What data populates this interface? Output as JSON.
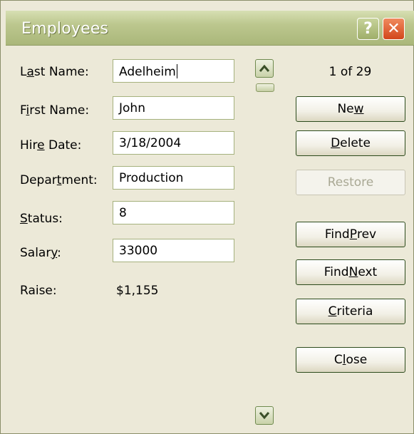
{
  "window": {
    "title": "Employees"
  },
  "titlebar": {
    "help_label": "?",
    "close_label": "✕"
  },
  "fields": {
    "last_name": {
      "label_pre": "L",
      "label_ul": "a",
      "label_post": "st Name:",
      "value": "Adelheim"
    },
    "first_name": {
      "label_pre": "F",
      "label_ul": "i",
      "label_post": "rst Name:",
      "value": "John"
    },
    "hire_date": {
      "label_pre": "Hir",
      "label_ul": "e",
      "label_post": " Date:",
      "value": "3/18/2004"
    },
    "department": {
      "label_pre": "Depar",
      "label_ul": "t",
      "label_post": "ment:",
      "value": "Production"
    },
    "status": {
      "label_pre": "",
      "label_ul": "S",
      "label_post": "tatus:",
      "value": "8"
    },
    "salary": {
      "label_pre": "Salar",
      "label_ul": "y",
      "label_post": ":",
      "value": "33000"
    }
  },
  "raise": {
    "label": "Raise:",
    "value": "$1,155"
  },
  "record_counter": "1 of 29",
  "buttons": {
    "new": {
      "pre": "Ne",
      "ul": "w",
      "post": ""
    },
    "delete": {
      "pre": "",
      "ul": "D",
      "post": "elete"
    },
    "restore": {
      "label": "Restore"
    },
    "find_prev": {
      "pre": "Find ",
      "ul": "P",
      "post": "rev"
    },
    "find_next": {
      "pre": "Find ",
      "ul": "N",
      "post": "ext"
    },
    "criteria": {
      "pre": "",
      "ul": "C",
      "post": "riteria"
    },
    "close": {
      "pre": "C",
      "ul": "l",
      "post": "ose"
    }
  },
  "icons": {
    "help": "question-mark-icon",
    "close": "close-x-icon",
    "scroll_up": "chevron-up-icon",
    "scroll_down": "chevron-down-icon"
  },
  "colors": {
    "dialog_bg": "#ECE9D8",
    "titlebar": "#AAB77A",
    "close_red": "#D2461B"
  }
}
